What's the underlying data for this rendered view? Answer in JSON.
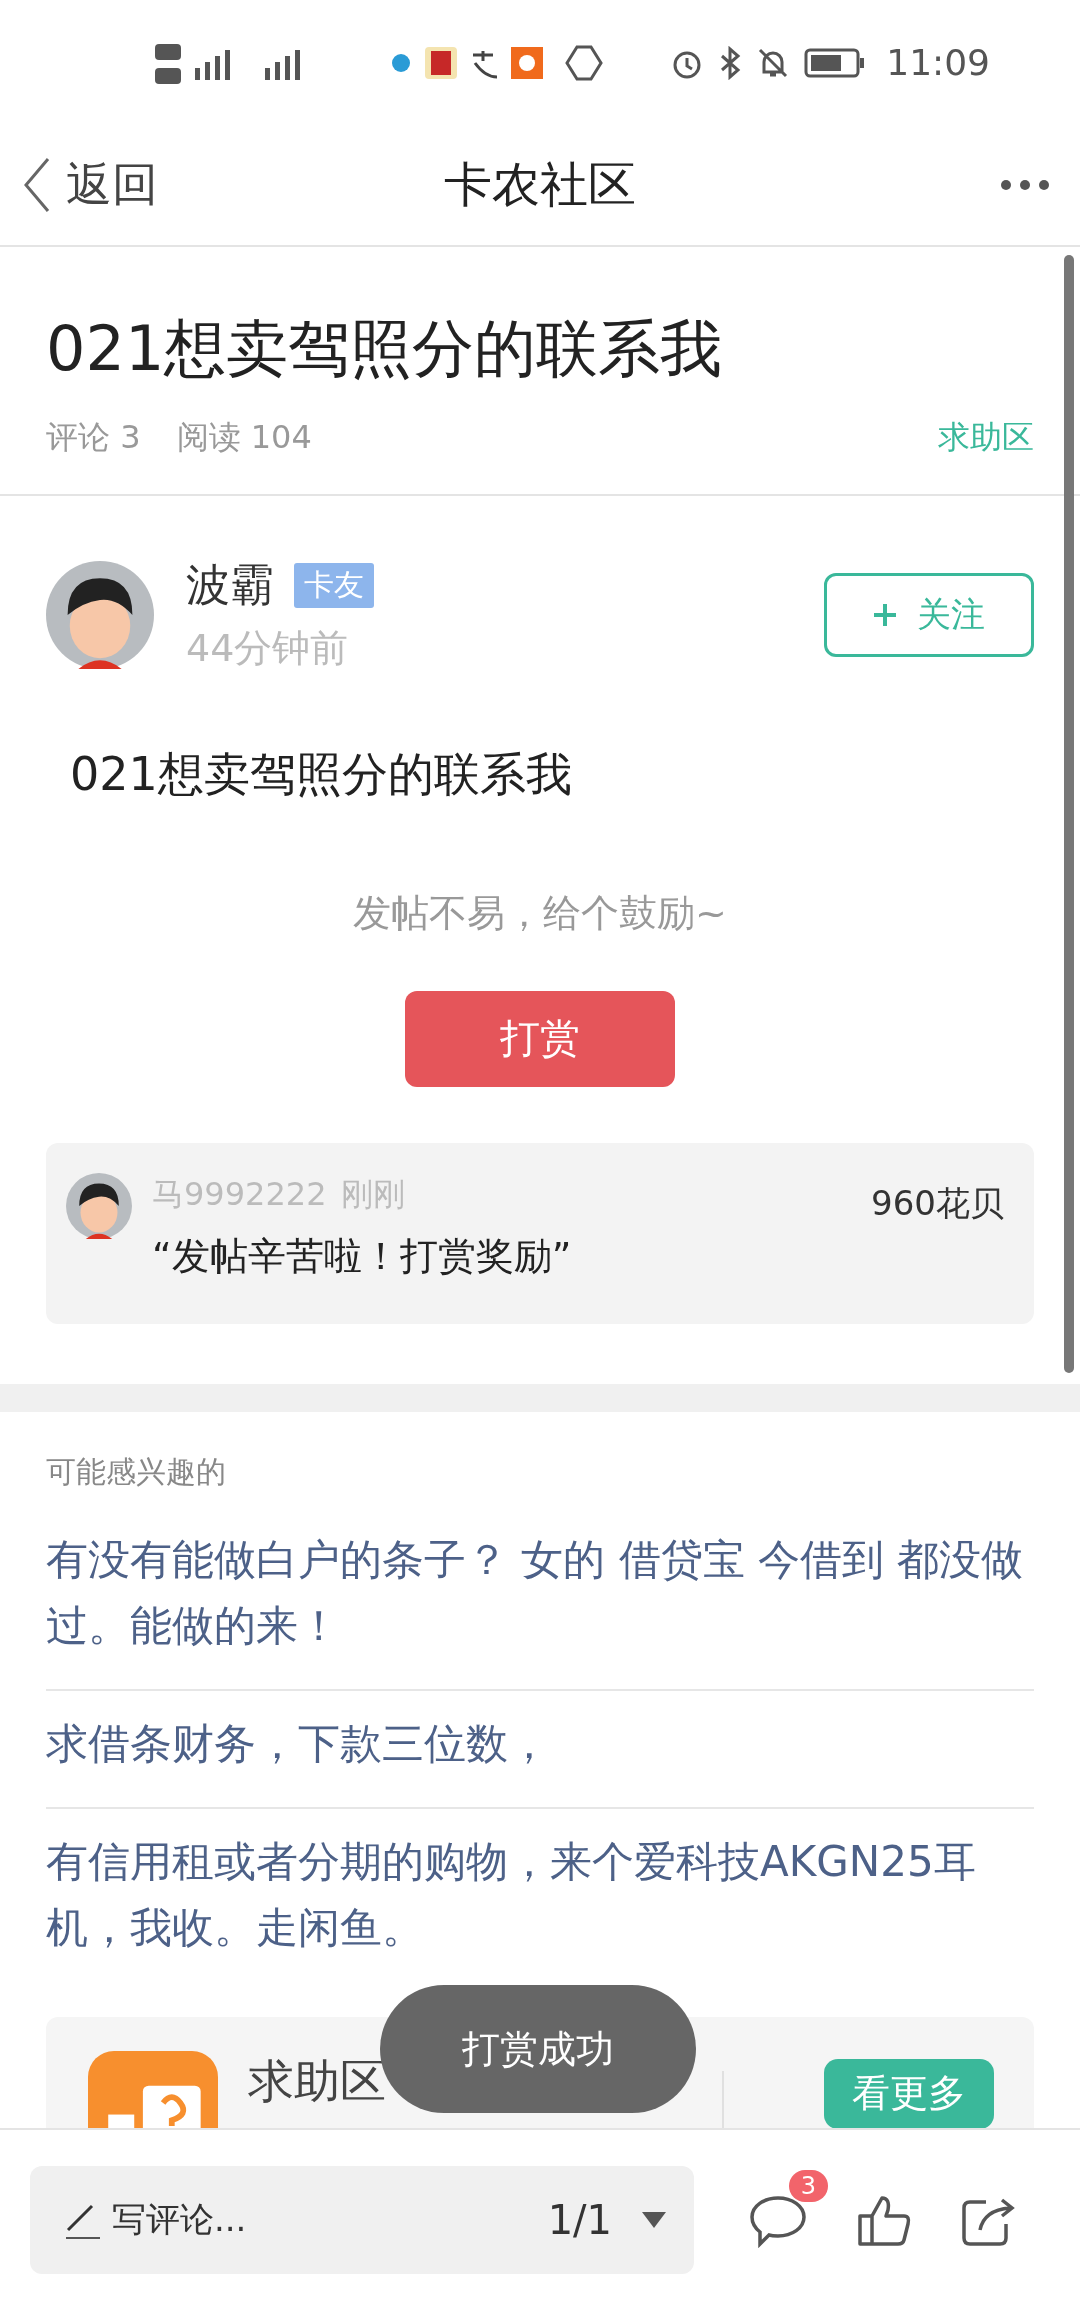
{
  "status_bar": {
    "time": "11:09"
  },
  "header": {
    "back_label": "返回",
    "title": "卡农社区"
  },
  "post": {
    "title": "021想卖驾照分的联系我",
    "comments": "评论 3",
    "reads": "阅读 104",
    "section": "求助区",
    "author": {
      "name": "波霸",
      "tag": "卡友",
      "time": "44分钟前",
      "follow_label": "关注"
    },
    "body": "021想卖驾照分的联系我",
    "reward_prompt": "发帖不易，给个鼓励~",
    "reward_button": "打赏",
    "rewards": [
      {
        "user": "马9992222",
        "time": "刚刚",
        "amount": "960花贝",
        "message": "“发帖辛苦啦！打赏奖励”"
      }
    ]
  },
  "related": {
    "heading": "可能感兴趣的",
    "items": [
      {
        "text": "有没有能做白户的条子？ 女的 借贷宝 今借到 都没做过。能做的来！"
      },
      {
        "text": "求借条财务，下款三位数，"
      },
      {
        "text": "有信用租或者分期的购物，来个爱科技AKGN25耳机，我收。走闲鱼。"
      }
    ],
    "section_card": {
      "name": "求助区",
      "more_label": "看更多"
    }
  },
  "toast": "打赏成功",
  "bottom_bar": {
    "comment_placeholder": "写评论...",
    "page": "1/1",
    "comment_badge": "3"
  }
}
